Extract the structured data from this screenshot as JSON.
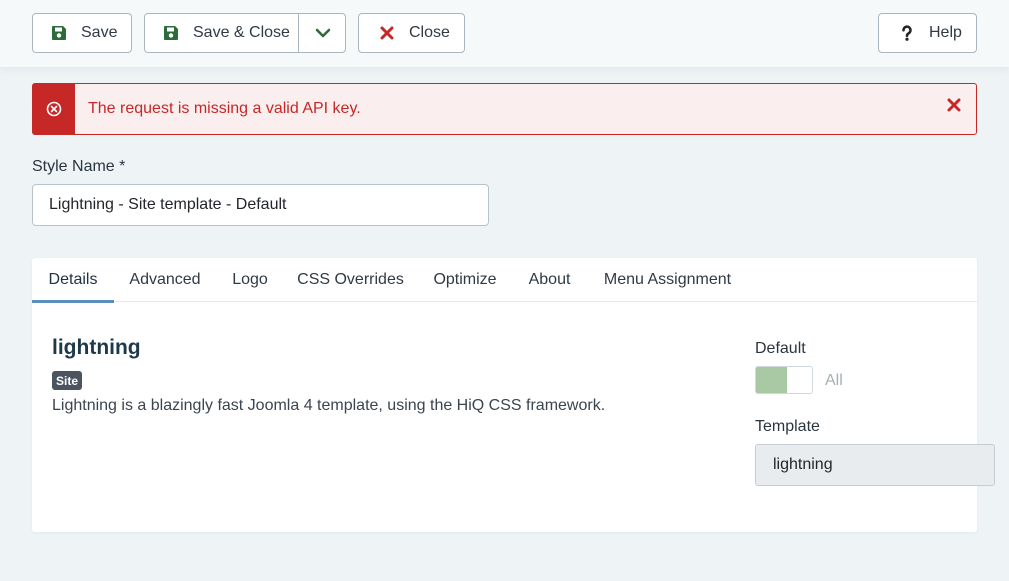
{
  "toolbar": {
    "save_label": "Save",
    "save_close_label": "Save & Close",
    "close_label": "Close",
    "help_label": "Help"
  },
  "alert": {
    "message": "The request is missing a valid API key."
  },
  "style_name": {
    "label": "Style Name *",
    "value": "Lightning - Site template - Default"
  },
  "tabs": [
    {
      "label": "Details",
      "active": true
    },
    {
      "label": "Advanced"
    },
    {
      "label": "Logo"
    },
    {
      "label": "CSS Overrides"
    },
    {
      "label": "Optimize"
    },
    {
      "label": "About"
    },
    {
      "label": "Menu Assignment"
    }
  ],
  "details": {
    "template_name": "lightning",
    "badge": "Site",
    "description": "Lightning is a blazingly fast Joomla 4 template, using the HiQ CSS framework.",
    "default_label": "Default",
    "default_option": "All",
    "template_label": "Template",
    "template_value": "lightning"
  },
  "colors": {
    "accent": "#5a8fbd",
    "danger": "#c52827",
    "save_green": "#2e6b3a",
    "switch_on": "#a8c9a4"
  },
  "icons": {
    "save": "floppy-disk-icon",
    "caret": "chevron-down-icon",
    "close": "x-icon",
    "help": "question-mark-icon",
    "alert": "circle-x-icon",
    "dismiss": "close-icon"
  }
}
